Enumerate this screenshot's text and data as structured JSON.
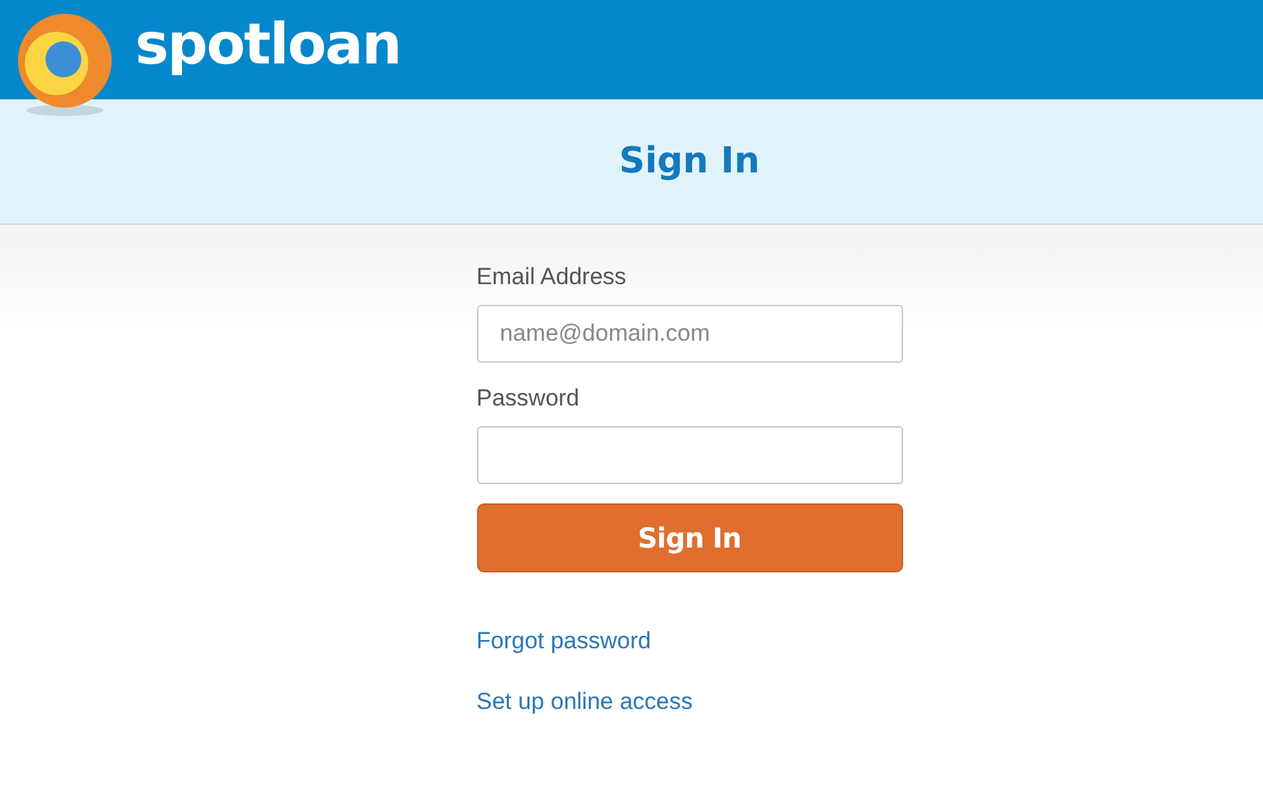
{
  "header": {
    "brand": "spotloan"
  },
  "title": "Sign In",
  "form": {
    "fields": [
      {
        "label": "Email Address",
        "placeholder": "name@domain.com"
      },
      {
        "label": "Password"
      }
    ],
    "submit": "Sign In"
  },
  "links": [
    "Forgot password",
    "Set up online access"
  ]
}
